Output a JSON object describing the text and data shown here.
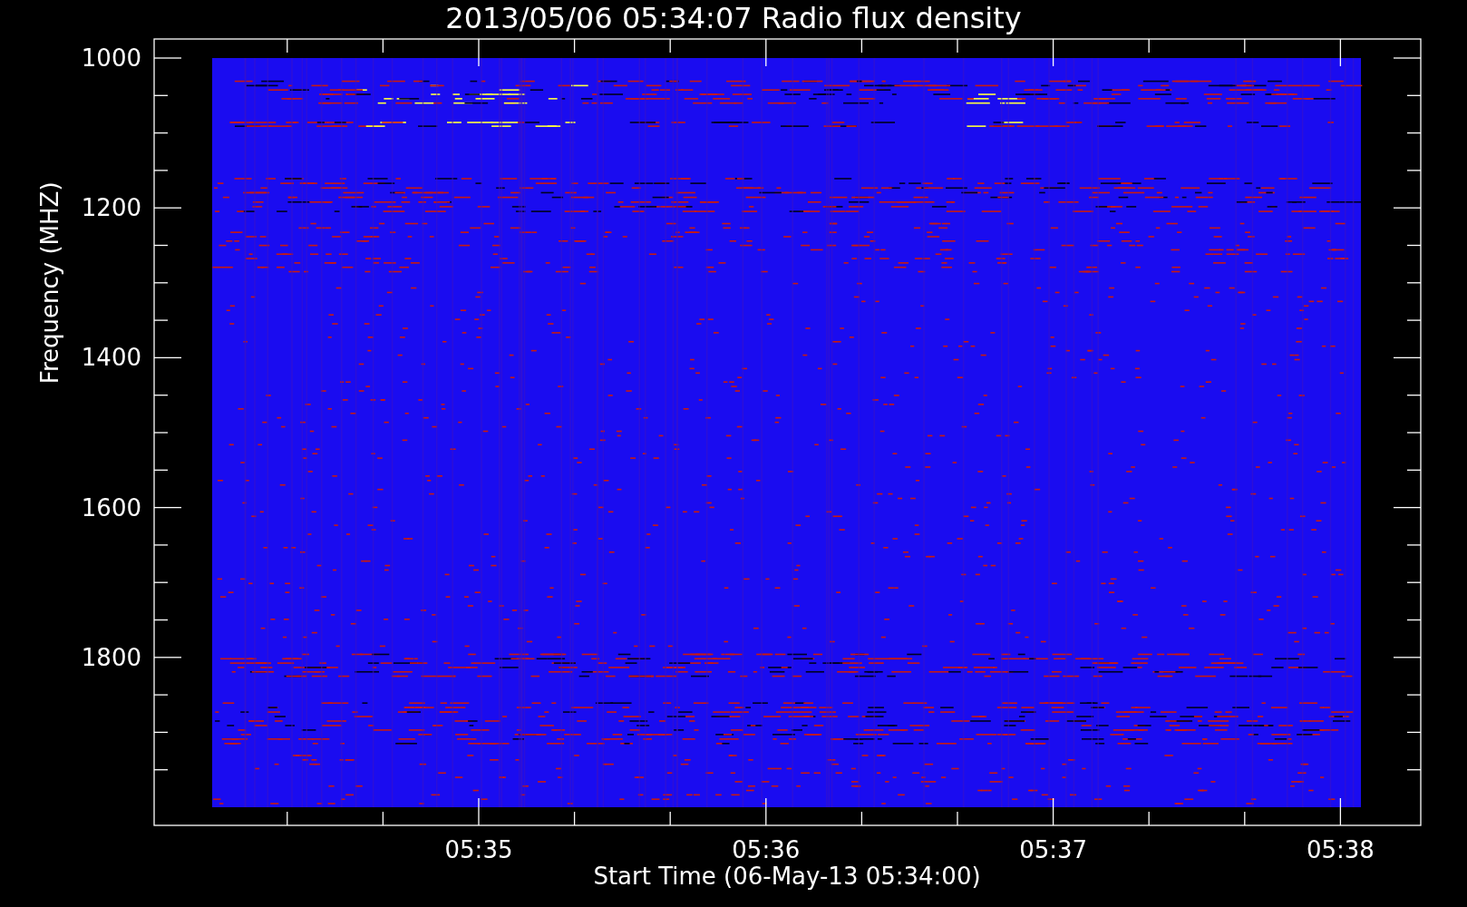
{
  "title": "2013/05/06 05:34:07 Radio flux density",
  "plot": {
    "ylabel": "Frequency (MHZ)",
    "xlabel": "Start Time (06-May-13 05:34:00)",
    "y_tick_labels": [
      "1000",
      "1200",
      "1400",
      "1600",
      "1800"
    ],
    "x_tick_labels": [
      "05:35",
      "05:36",
      "05:37",
      "05:38"
    ]
  }
}
